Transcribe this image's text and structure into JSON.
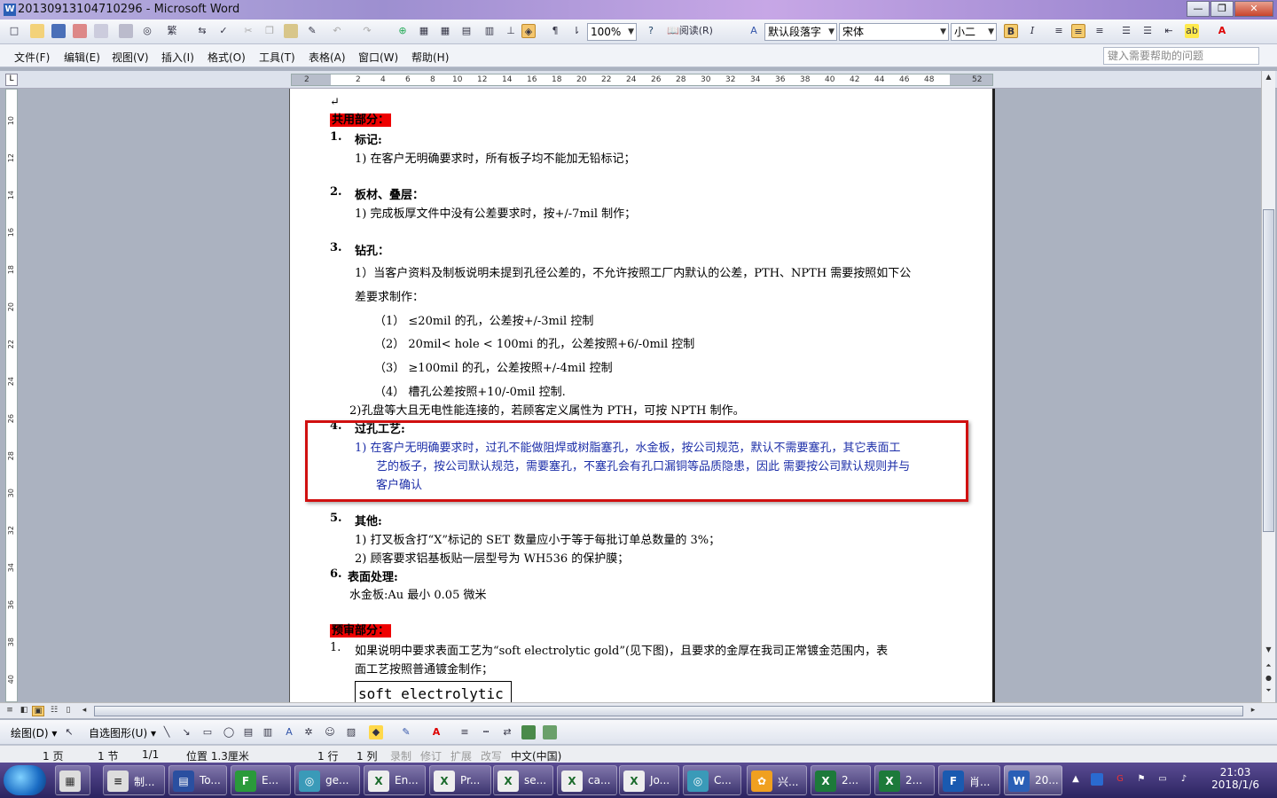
{
  "window": {
    "title": "20130913104710296 - Microsoft Word",
    "app_icon": "W",
    "controls": {
      "minimize": "—",
      "maximize": "❐",
      "close": "✕"
    }
  },
  "toolbar": {
    "zoom": "100%",
    "reading_label": "阅读(R)",
    "style": "默认段落字",
    "font": "宋体",
    "font_size": "小二",
    "bold": "B",
    "italic": "I",
    "font_color_glyph": "A"
  },
  "menubar": {
    "items": [
      "文件(F)",
      "编辑(E)",
      "视图(V)",
      "插入(I)",
      "格式(O)",
      "工具(T)",
      "表格(A)",
      "窗口(W)",
      "帮助(H)"
    ],
    "help_placeholder": "键入需要帮助的问题"
  },
  "ruler": {
    "ticks": [
      "2",
      "2",
      "4",
      "6",
      "8",
      "10",
      "12",
      "14",
      "16",
      "18",
      "20",
      "22",
      "24",
      "26",
      "28",
      "30",
      "32",
      "34",
      "36",
      "38",
      "40",
      "42",
      "44",
      "46",
      "48",
      "52"
    ],
    "vticks": [
      "10",
      "12",
      "14",
      "16",
      "18",
      "20",
      "22",
      "24",
      "26",
      "28",
      "30",
      "32",
      "34",
      "36",
      "38",
      "40"
    ]
  },
  "document": {
    "section1_title": "共用部分：",
    "s1_num": "1.",
    "s1_title": "标记:",
    "s1_1": "1)  在客户无明确要求时，所有板子均不能加无铅标记；",
    "s2_num": "2.",
    "s2_title": "板材、叠层：",
    "s2_1": "1)  完成板厚文件中没有公差要求时，按+/-7mil 制作；",
    "s3_num": "3.",
    "s3_title": "钻孔：",
    "s3_1a": "1）当客户资料及制板说明未提到孔径公差的，不允许按照工厂内默认的公差，PTH、NPTH 需要按照如下公",
    "s3_1b": "差要求制作：",
    "s3_i1": "（1）  ≤20mil 的孔，公差按+/-3mil 控制",
    "s3_i2": "（2）  20mil< hole < 100mi 的孔，公差按照+6/-0mil 控制",
    "s3_i3": "（3）  ≥100mil 的孔，公差按照+/-4mil 控制",
    "s3_i4": "（4）  槽孔公差按照+10/-0mil 控制.",
    "s3_2": "2)孔盘等大且无电性能连接的，若顾客定义属性为 PTH，可按 NPTH 制作。",
    "s4_num": "4.",
    "s4_title": "过孔工艺:",
    "s4_1a": "1)  在客户无明确要求时，过孔不能做阻焊或树脂塞孔，水金板，按公司规范，默认不需要塞孔，其它表面工",
    "s4_1b": "艺的板子，按公司默认规范，需要塞孔，不塞孔会有孔口漏铜等品质隐患，因此 需要按公司默认规则并与",
    "s4_1c": "客户确认",
    "s5_num": "5.",
    "s5_title": "其他:",
    "s5_1": "1)  打叉板含打“X”标记的 SET 数量应小于等于每批订单总数量的 3%；",
    "s5_2": "2)  顾客要求铝基板贴一层型号为 WH536 的保护膜；",
    "s6_num": "6.",
    "s6_title": "表面处理:",
    "s6_1": "水金板:Au 最小 0.05 微米",
    "section2_title": "预审部分：",
    "p1_num": "1.",
    "p1_a": "如果说明中要求表面工艺为“soft electrolytic gold”(见下图)，且要求的金厚在我司正常镀金范围内，表",
    "p1_b": "面工艺按照普通镀金制作；",
    "boxed": "soft electrolytic gold",
    "para_mark": "↵"
  },
  "drawbar": {
    "draw_label": "绘图(D) ▾",
    "autoshape_label": "自选图形(U) ▾"
  },
  "status": {
    "page": "1 页",
    "section": "1 节",
    "pages": "1/1",
    "position": "位置 1.3厘米",
    "line": "1 行",
    "column": "1 列",
    "rec": "录制",
    "trk": "修订",
    "ext": "扩展",
    "ovr": "改写",
    "lang": "中文(中国)"
  },
  "taskbar": {
    "tasks": [
      {
        "icon": "≡",
        "label": "制..."
      },
      {
        "icon": "▤",
        "label": "To..."
      },
      {
        "icon": "F",
        "label": "E..."
      },
      {
        "icon": "◎",
        "label": "ge..."
      },
      {
        "icon": "X",
        "label": "En..."
      },
      {
        "icon": "X",
        "label": "Pr..."
      },
      {
        "icon": "X",
        "label": "se..."
      },
      {
        "icon": "X",
        "label": "ca..."
      },
      {
        "icon": "X",
        "label": "Jo..."
      },
      {
        "icon": "◎",
        "label": "C..."
      },
      {
        "icon": "✿",
        "label": "兴..."
      },
      {
        "icon": "X",
        "label": "2..."
      },
      {
        "icon": "X",
        "label": "2..."
      },
      {
        "icon": "F",
        "label": "肖..."
      },
      {
        "icon": "W",
        "label": "20..."
      }
    ],
    "time": "21:03",
    "date": "2018/1/6"
  }
}
